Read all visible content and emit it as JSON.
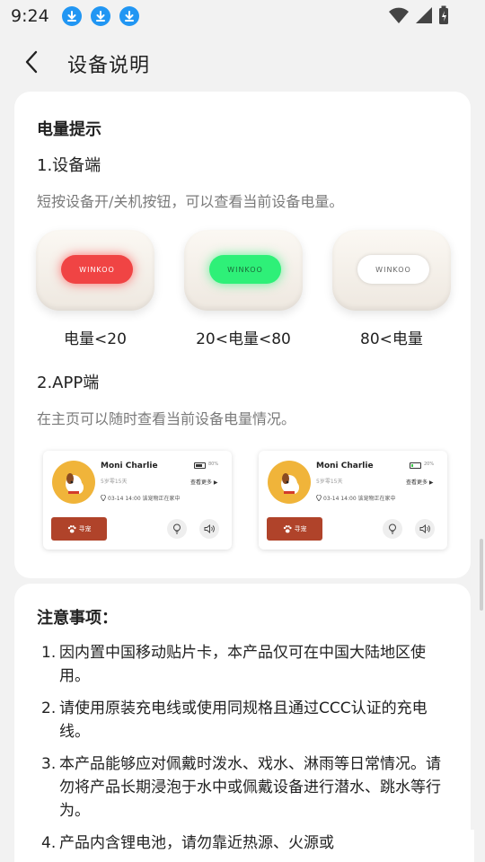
{
  "status_bar": {
    "time": "9:24"
  },
  "header": {
    "title": "设备说明"
  },
  "battery_section": {
    "title": "电量提示",
    "device_subtitle": "1.设备端",
    "device_desc": "短按设备开/关机按钮，可以查看当前设备电量。",
    "devices": [
      {
        "brand": "WINKOO",
        "caption": "电量<20",
        "led_color": "#f04444"
      },
      {
        "brand": "WINKOO",
        "caption": "20<电量<80",
        "led_color": "#2ef078"
      },
      {
        "brand": "WINKOO",
        "caption": "80<电量",
        "led_color": "#ffffff"
      }
    ],
    "app_subtitle": "2.APP端",
    "app_desc": "在主页可以随时查看当前设备电量情况。",
    "app_shots": [
      {
        "pet_name": "Moni Charlie",
        "age": "5岁零15天",
        "battery_pct": "80%",
        "battery_level": 0.8,
        "see_more": "查看更多 ▶",
        "location": "03-14  14:00 该宠物正在家中",
        "find_label": "寻宠"
      },
      {
        "pet_name": "Moni Charlie",
        "age": "5岁零15天",
        "battery_pct": "20%",
        "battery_level": 0.2,
        "see_more": "查看更多 ▶",
        "location": "03-14  14:00 该宠物正在家中",
        "find_label": "寻宠"
      }
    ]
  },
  "notes": {
    "title": "注意事项：",
    "items": [
      {
        "num": "1.",
        "text": "因内置中国移动贴片卡，本产品仅可在中国大陆地区使用。"
      },
      {
        "num": "2.",
        "text": "请使用原装充电线或使用同规格且通过CCC认证的充电线。"
      },
      {
        "num": "3.",
        "text": "本产品能够应对佩戴时泼水、戏水、淋雨等日常情况。请勿将产品长期浸泡于水中或佩戴设备进行潜水、跳水等行为。"
      },
      {
        "num": "4.",
        "text": "产品内含锂电池，请勿靠近热源、火源或"
      }
    ]
  },
  "colors": {
    "accent": "#b0432a",
    "avatar_bg": "#f0b43a",
    "download_icon": "#2196f3"
  }
}
